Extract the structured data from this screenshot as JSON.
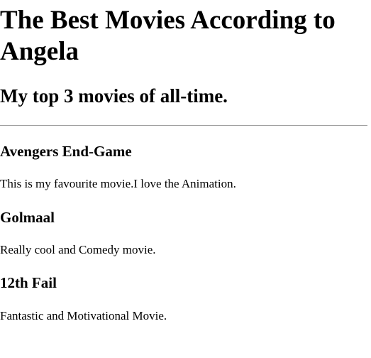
{
  "page": {
    "title": "The Best Movies According to Angela",
    "subtitle": "My top 3 movies of all-time."
  },
  "movies": [
    {
      "title": "Avengers End-Game",
      "description": "This is my favourite movie.I love the Animation."
    },
    {
      "title": "Golmaal",
      "description": "Really cool and Comedy movie."
    },
    {
      "title": "12th Fail",
      "description": "Fantastic and Motivational Movie."
    }
  ],
  "colors": {
    "text": "#000000",
    "background": "#ffffff",
    "divider": "#9a9a9a"
  }
}
